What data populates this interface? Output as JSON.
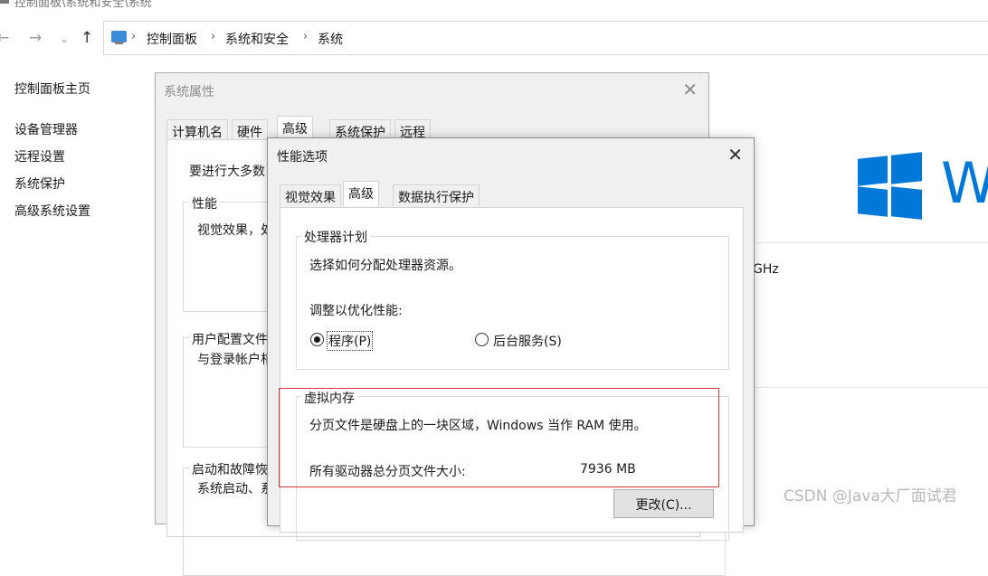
{
  "window": {
    "title": "控制面板\\系统和安全\\系统",
    "breadcrumb": [
      "控制面板",
      "系统和安全",
      "系统"
    ]
  },
  "left_nav": {
    "home": "控制面板主页",
    "items": [
      "设备管理器",
      "远程设置",
      "系统保护",
      "高级系统设置"
    ]
  },
  "background": {
    "ghz_text": "GHz",
    "brand_text": "W",
    "watermark": "CSDN @Java大厂面试君"
  },
  "system_properties": {
    "title": "系统属性",
    "tabs": [
      "计算机名",
      "硬件",
      "高级",
      "系统保护",
      "远程"
    ],
    "active_tab": "高级",
    "intro": "要进行大多数",
    "performance_label": "性能",
    "performance_text": "视觉效果，处",
    "user_profile_label": "用户配置文件",
    "user_profile_text": "与登录帐户相",
    "startup_label": "启动和故障恢",
    "startup_text": "系统启动、系"
  },
  "performance_options": {
    "title": "性能选项",
    "tabs": [
      "视觉效果",
      "高级",
      "数据执行保护"
    ],
    "active_tab": "高级",
    "processor": {
      "label": "处理器计划",
      "desc": "选择如何分配处理器资源。",
      "adjust": "调整以优化性能:",
      "option_programs": "程序(P)",
      "option_services": "后台服务(S)",
      "selected": "程序(P)"
    },
    "virtual_memory": {
      "label": "虚拟内存",
      "desc": "分页文件是硬盘上的一块区域，Windows 当作 RAM 使用。",
      "total_label": "所有驱动器总分页文件大小:",
      "total_value": "7936 MB",
      "change_button": "更改(C)..."
    }
  },
  "colors": {
    "accent": "#0078d7",
    "annotation_red": "#e0261c"
  }
}
